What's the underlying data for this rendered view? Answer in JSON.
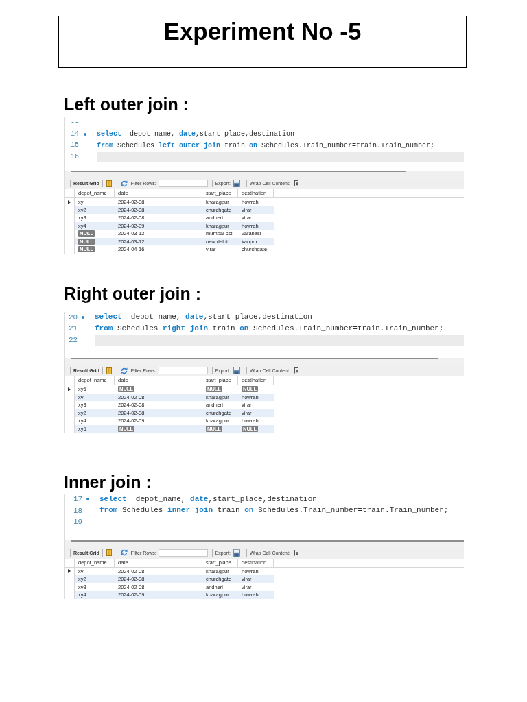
{
  "document": {
    "title": "Experiment No -5"
  },
  "sections": [
    {
      "heading": "Left outer join :",
      "editor": {
        "lines": [
          {
            "number": "--",
            "marked": false,
            "highlighted": false
          },
          {
            "number": "14",
            "marked": true,
            "highlighted": false,
            "code": "**select**  depot_name, **date**,start_place,destination"
          },
          {
            "number": "15",
            "marked": false,
            "highlighted": false,
            "code": "**from** Schedules **left outer join** train **on** Schedules.Train_number=train.Train_number;"
          },
          {
            "number": "16",
            "marked": false,
            "highlighted": true
          }
        ]
      },
      "toolbar": {
        "result_grid": "Result Grid",
        "filter_label": "Filter Rows:",
        "export_label": "Export:",
        "wrap_label": "Wrap Cell Content:"
      },
      "table": {
        "columns": [
          "depot_name",
          "date",
          "start_place",
          "destination"
        ],
        "rows": [
          {
            "selected": true,
            "cells": [
              {
                "kind": "text",
                "text": "xy"
              },
              {
                "kind": "text",
                "text": "2024-02-08"
              },
              {
                "kind": "text",
                "text": "kharagpur"
              },
              {
                "kind": "text",
                "text": "howrah"
              }
            ]
          },
          {
            "selected": false,
            "cells": [
              {
                "kind": "text",
                "text": "xy2"
              },
              {
                "kind": "text",
                "text": "2024-02-08"
              },
              {
                "kind": "text",
                "text": "churchgate"
              },
              {
                "kind": "text",
                "text": "virar"
              }
            ]
          },
          {
            "selected": false,
            "cells": [
              {
                "kind": "text",
                "text": "xy3"
              },
              {
                "kind": "text",
                "text": "2024-02-08"
              },
              {
                "kind": "text",
                "text": "andheri"
              },
              {
                "kind": "text",
                "text": "virar"
              }
            ]
          },
          {
            "selected": false,
            "cells": [
              {
                "kind": "text",
                "text": "xy4"
              },
              {
                "kind": "text",
                "text": "2024-02-09"
              },
              {
                "kind": "text",
                "text": "kharagpur"
              },
              {
                "kind": "text",
                "text": "howrah"
              }
            ]
          },
          {
            "selected": false,
            "cells": [
              {
                "kind": "null",
                "text": "NULL"
              },
              {
                "kind": "text",
                "text": "2024-03-12"
              },
              {
                "kind": "text",
                "text": "mumbai cst"
              },
              {
                "kind": "text",
                "text": "varanasi"
              }
            ]
          },
          {
            "selected": false,
            "cells": [
              {
                "kind": "null",
                "text": "NULL"
              },
              {
                "kind": "text",
                "text": "2024-03-12"
              },
              {
                "kind": "text",
                "text": "new delhi"
              },
              {
                "kind": "text",
                "text": "kanpur"
              }
            ]
          },
          {
            "selected": false,
            "cells": [
              {
                "kind": "null",
                "text": "NULL"
              },
              {
                "kind": "text",
                "text": "2024-04-16"
              },
              {
                "kind": "text",
                "text": "virar"
              },
              {
                "kind": "text",
                "text": "churchgate"
              }
            ]
          }
        ]
      }
    },
    {
      "heading": "Right outer join :",
      "editor": {
        "lines": [
          {
            "number": "20",
            "marked": true,
            "highlighted": false,
            "code": "**select**  depot_name, **date**,start_place,destination"
          },
          {
            "number": "21",
            "marked": false,
            "highlighted": false,
            "code": "**from** Schedules **right join** train **on** Schedules.Train_number=train.Train_number;"
          },
          {
            "number": "22",
            "marked": false,
            "highlighted": true
          }
        ]
      },
      "toolbar": {
        "result_grid": "Result Grid",
        "filter_label": "Filter Rows:",
        "export_label": "Export:",
        "wrap_label": "Wrap Cell Content:"
      },
      "table": {
        "columns": [
          "depot_name",
          "date",
          "start_place",
          "destination"
        ],
        "rows": [
          {
            "selected": true,
            "cells": [
              {
                "kind": "text",
                "text": "xy5"
              },
              {
                "kind": "null",
                "text": "NULL"
              },
              {
                "kind": "null",
                "text": "NULL"
              },
              {
                "kind": "null",
                "text": "NULL"
              }
            ]
          },
          {
            "selected": false,
            "cells": [
              {
                "kind": "text",
                "text": "xy"
              },
              {
                "kind": "text",
                "text": "2024-02-08"
              },
              {
                "kind": "text",
                "text": "kharagpur"
              },
              {
                "kind": "text",
                "text": "howrah"
              }
            ]
          },
          {
            "selected": false,
            "cells": [
              {
                "kind": "text",
                "text": "xy3"
              },
              {
                "kind": "text",
                "text": "2024-02-08"
              },
              {
                "kind": "text",
                "text": "andheri"
              },
              {
                "kind": "text",
                "text": "virar"
              }
            ]
          },
          {
            "selected": false,
            "cells": [
              {
                "kind": "text",
                "text": "xy2"
              },
              {
                "kind": "text",
                "text": "2024-02-08"
              },
              {
                "kind": "text",
                "text": "churchgate"
              },
              {
                "kind": "text",
                "text": "virar"
              }
            ]
          },
          {
            "selected": false,
            "cells": [
              {
                "kind": "text",
                "text": "xy4"
              },
              {
                "kind": "text",
                "text": "2024-02-09"
              },
              {
                "kind": "text",
                "text": "kharagpur"
              },
              {
                "kind": "text",
                "text": "howrah"
              }
            ]
          },
          {
            "selected": false,
            "cells": [
              {
                "kind": "text",
                "text": "xy6"
              },
              {
                "kind": "null",
                "text": "NULL"
              },
              {
                "kind": "null",
                "text": "NULL"
              },
              {
                "kind": "null",
                "text": "NULL"
              }
            ]
          }
        ]
      }
    },
    {
      "heading": "Inner join :",
      "editor": {
        "lines": [
          {
            "number": "17",
            "marked": true,
            "highlighted": false,
            "code": "**select**  depot_name, **date**,start_place,destination"
          },
          {
            "number": "18",
            "marked": false,
            "highlighted": false,
            "code": "**from** Schedules **inner join** train **on** Schedules.Train_number=train.Train_number;"
          },
          {
            "number": "19",
            "marked": false,
            "highlighted": false
          }
        ]
      },
      "toolbar": {
        "result_grid": "Result Grid",
        "filter_label": "Filter Rows:",
        "export_label": "Export:",
        "wrap_label": "Wrap Cell Content:"
      },
      "table": {
        "columns": [
          "depot_name",
          "date",
          "start_place",
          "destination"
        ],
        "rows": [
          {
            "selected": true,
            "cells": [
              {
                "kind": "text",
                "text": "xy"
              },
              {
                "kind": "text",
                "text": "2024-02-08"
              },
              {
                "kind": "text",
                "text": "kharagpur"
              },
              {
                "kind": "text",
                "text": "howrah"
              }
            ]
          },
          {
            "selected": false,
            "cells": [
              {
                "kind": "text",
                "text": "xy2"
              },
              {
                "kind": "text",
                "text": "2024-02-08"
              },
              {
                "kind": "text",
                "text": "churchgate"
              },
              {
                "kind": "text",
                "text": "virar"
              }
            ]
          },
          {
            "selected": false,
            "cells": [
              {
                "kind": "text",
                "text": "xy3"
              },
              {
                "kind": "text",
                "text": "2024-02-08"
              },
              {
                "kind": "text",
                "text": "andheri"
              },
              {
                "kind": "text",
                "text": "virar"
              }
            ]
          },
          {
            "selected": false,
            "cells": [
              {
                "kind": "text",
                "text": "xy4"
              },
              {
                "kind": "text",
                "text": "2024-02-09"
              },
              {
                "kind": "text",
                "text": "kharagpur"
              },
              {
                "kind": "text",
                "text": "howrah"
              }
            ]
          }
        ]
      }
    }
  ]
}
